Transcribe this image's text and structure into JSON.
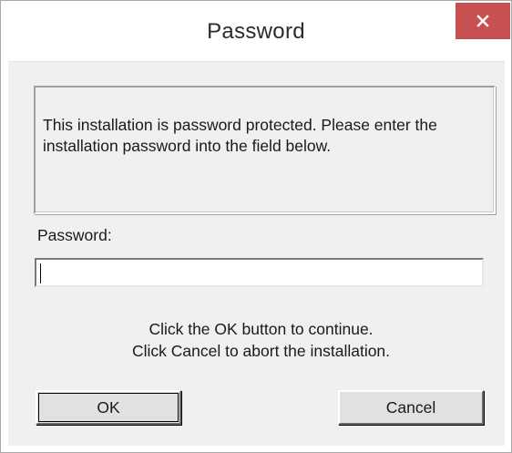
{
  "window": {
    "title": "Password",
    "close_icon": "close-icon",
    "accent_close_color": "#c75050"
  },
  "message": {
    "text": "This installation is password protected. Please enter the installation password into the field below."
  },
  "password": {
    "label": "Password:",
    "value": "",
    "placeholder": ""
  },
  "instructions": {
    "line1": "Click the OK button to continue.",
    "line2": "Click Cancel to abort the installation."
  },
  "buttons": {
    "ok_label": "OK",
    "cancel_label": "Cancel"
  }
}
